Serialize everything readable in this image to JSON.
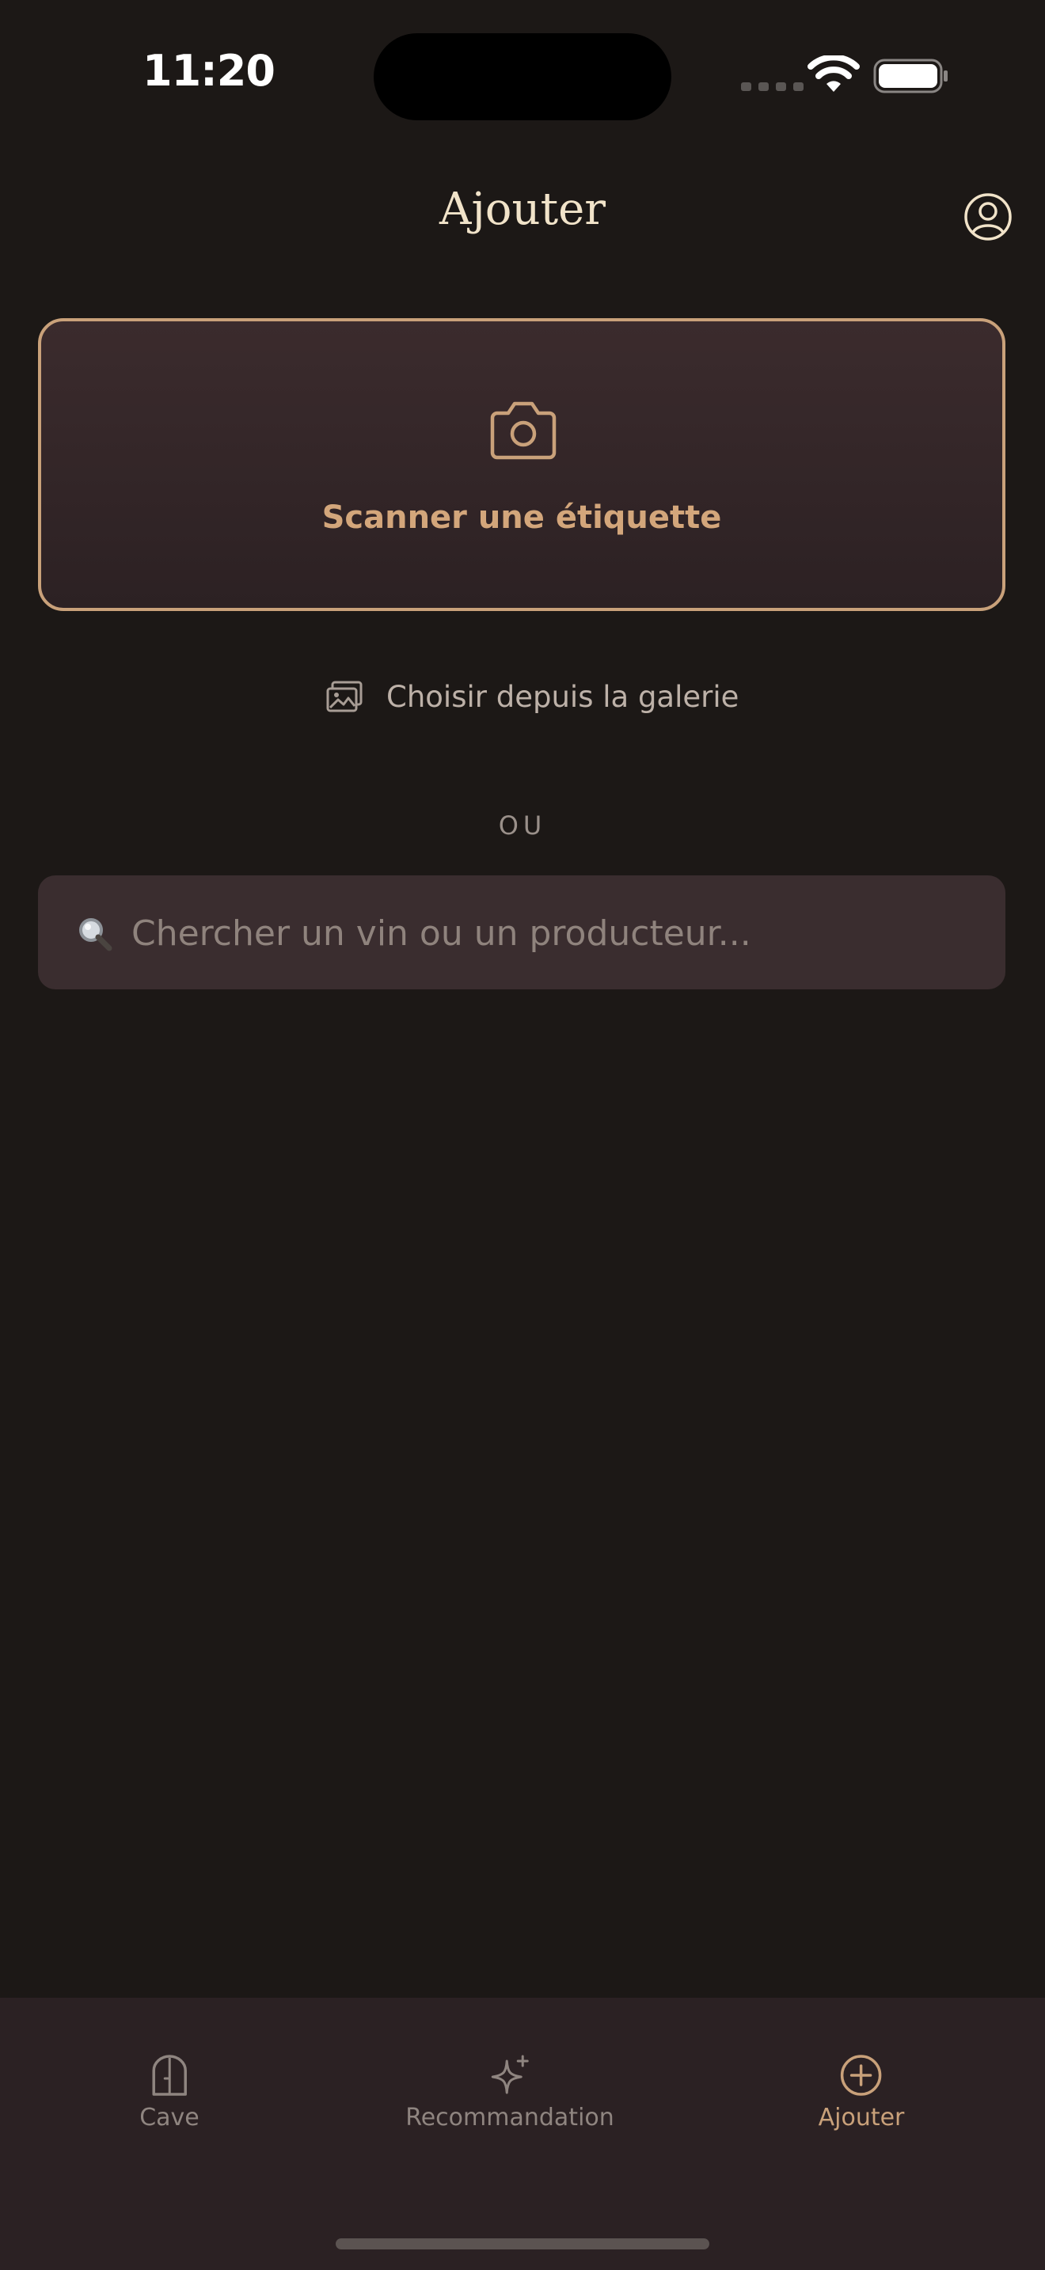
{
  "status_bar": {
    "time": "11:20"
  },
  "header": {
    "title": "Ajouter",
    "profile_icon": "person-circle-icon"
  },
  "scan_card": {
    "icon": "camera-icon",
    "label": "Scanner une étiquette"
  },
  "gallery": {
    "icon": "photo-gallery-icon",
    "label": "Choisir depuis la galerie"
  },
  "divider": {
    "label": "OU"
  },
  "search": {
    "icon": "magnifying-glass-icon",
    "placeholder": "Chercher un vin ou un producteur...",
    "value": ""
  },
  "tab_bar": {
    "items": [
      {
        "label": "Cave",
        "icon": "cellar-door-icon",
        "active": false
      },
      {
        "label": "Recommandation",
        "icon": "sparkle-icon",
        "active": false
      },
      {
        "label": "Ajouter",
        "icon": "plus-circle-icon",
        "active": true
      }
    ]
  },
  "colors": {
    "background": "#1c1816",
    "accent": "#c9a17a",
    "card": "#3a2d2f",
    "tab_bar": "#2b2123",
    "title": "#f1e3c9"
  }
}
